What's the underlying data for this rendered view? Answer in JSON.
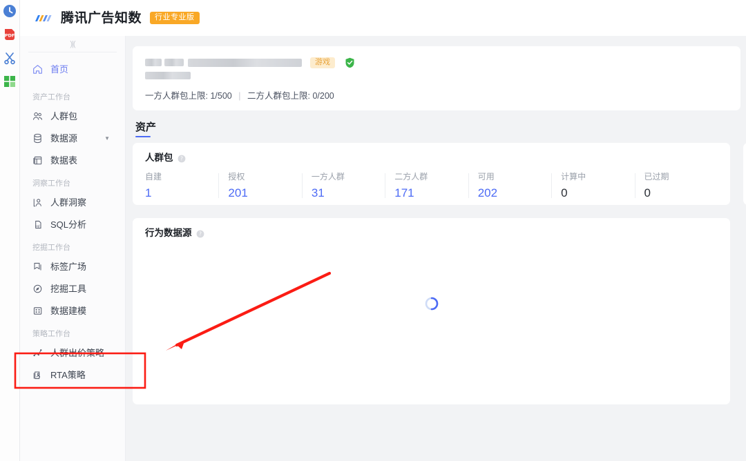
{
  "ext_rail": {
    "items": [
      {
        "name": "clock-icon",
        "label": "历史记录",
        "color": "#4a7fd4"
      },
      {
        "name": "pdf-icon",
        "label": "PDF",
        "color": "#e8413a"
      },
      {
        "name": "scissors-icon",
        "label": "截图",
        "color": "#4a7fd4"
      },
      {
        "name": "grid-icon",
        "label": "表格",
        "color": "#3cb54a"
      }
    ]
  },
  "topbar": {
    "brand": "腾讯广告知数",
    "badge": "行业专业版"
  },
  "sidebar": {
    "collapse_glyph": ")|(",
    "home": {
      "label": "首页",
      "icon": "home-icon"
    },
    "groups": [
      {
        "title": "资产工作台",
        "items": [
          {
            "label": "人群包",
            "icon": "people-icon",
            "caret": false
          },
          {
            "label": "数据源",
            "icon": "database-icon",
            "caret": true
          },
          {
            "label": "数据表",
            "icon": "table-icon",
            "caret": false
          }
        ]
      },
      {
        "title": "洞察工作台",
        "items": [
          {
            "label": "人群洞察",
            "icon": "insight-icon",
            "caret": false
          },
          {
            "label": "SQL分析",
            "icon": "sql-icon",
            "caret": false
          }
        ]
      },
      {
        "title": "挖掘工作台",
        "items": [
          {
            "label": "标签广场",
            "icon": "tag-icon",
            "caret": false
          },
          {
            "label": "挖掘工具",
            "icon": "compass-icon",
            "caret": false
          },
          {
            "label": "数据建模",
            "icon": "model-icon",
            "caret": false
          }
        ]
      },
      {
        "title": "策略工作台",
        "items": [
          {
            "label": "人群出价策略",
            "icon": "strategy-icon",
            "caret": false
          },
          {
            "label": "RTA策略",
            "icon": "rta-icon",
            "caret": false
          }
        ]
      }
    ]
  },
  "account": {
    "tag": "游戏",
    "verified_icon": "verified-shield-icon",
    "limits_first_label": "一方人群包上限:",
    "limits_first_value": "1/500",
    "limits_separator": "|",
    "limits_second_label": "二方人群包上限:",
    "limits_second_value": "0/200"
  },
  "section": {
    "tab_label": "资产"
  },
  "crowd_pack_card": {
    "title": "人群包",
    "help_icon": "help-icon",
    "stats": [
      {
        "label": "自建",
        "value": "1",
        "accent": true
      },
      {
        "label": "授权",
        "value": "201",
        "accent": true
      },
      {
        "label": "一方人群",
        "value": "31",
        "accent": true
      },
      {
        "label": "二方人群",
        "value": "171",
        "accent": true
      },
      {
        "label": "可用",
        "value": "202",
        "accent": true
      },
      {
        "label": "计算中",
        "value": "0",
        "accent": false
      },
      {
        "label": "已过期",
        "value": "0",
        "accent": false
      }
    ]
  },
  "behavior_card": {
    "title": "行为数据源",
    "help_icon": "help-icon",
    "loading_icon": "loading-spinner-icon"
  },
  "annotations": {
    "highlight_box": {
      "name": "strategy-section-highlight",
      "color": "#fb1c14"
    },
    "arrow": {
      "name": "pointer-arrow",
      "color": "#fb1c14"
    }
  },
  "colors": {
    "accent_blue": "#4d6bf5",
    "nav_active": "#6b7bf0",
    "badge_orange": "#f9a826",
    "tag_orange_bg": "#fdeccd",
    "tag_orange_fg": "#e8a33a",
    "annotation_red": "#fb1c14",
    "page_bg": "#f2f3f5"
  }
}
